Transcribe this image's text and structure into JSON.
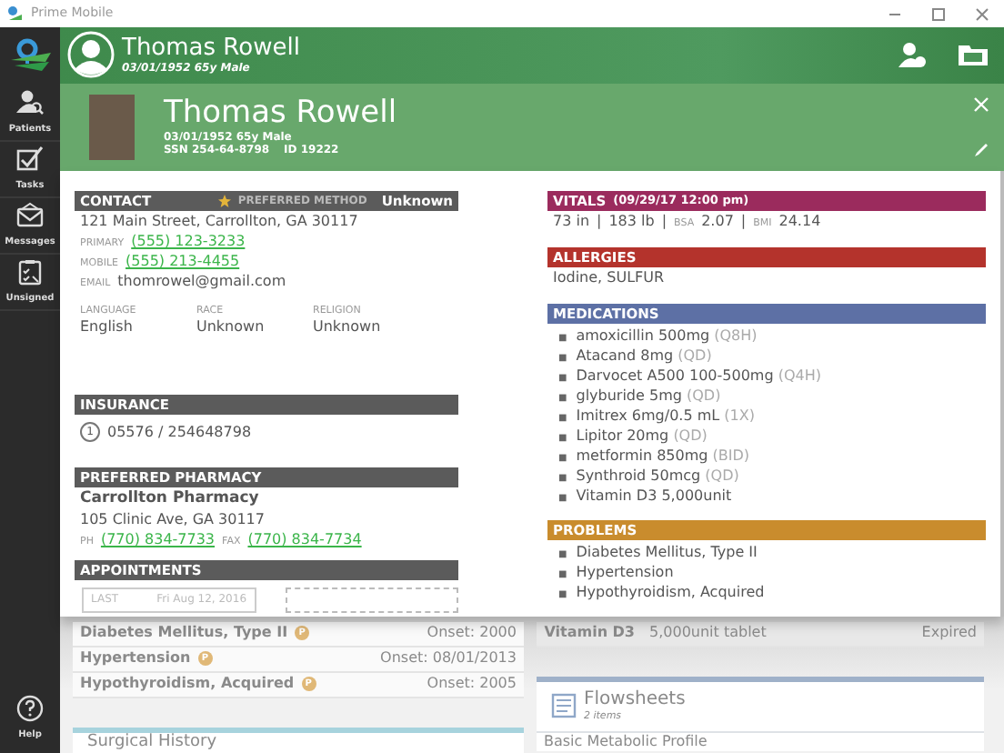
{
  "app": {
    "title": "Prime Mobile"
  },
  "sidebar": {
    "items": [
      {
        "kind": "patients",
        "label": "Patients"
      },
      {
        "kind": "tasks",
        "label": "Tasks"
      },
      {
        "kind": "messages",
        "label": "Messages"
      },
      {
        "kind": "unsigned",
        "label": "Unsigned"
      }
    ],
    "help": "Help"
  },
  "header": {
    "name": "Thomas Rowell",
    "info": "03/01/1952 65y Male"
  },
  "patient": {
    "name": "Thomas Rowell",
    "info": "03/01/1952 65y Male",
    "ssn": "SSN 254-64-8798",
    "id": "ID 19222"
  },
  "contact": {
    "title": "CONTACT",
    "preferred_label": "PREFERRED METHOD",
    "preferred_value": "Unknown",
    "address": "121 Main Street, Carrollton, GA 30117",
    "lines": [
      {
        "kind": "link",
        "label": "PRIMARY",
        "value": "(555) 123-3233"
      },
      {
        "kind": "link",
        "label": "MOBILE",
        "value": "(555) 213-4455"
      },
      {
        "kind": "text",
        "label": "EMAIL",
        "value": "thomrowel@gmail.com"
      }
    ],
    "demographics": [
      {
        "label": "LANGUAGE",
        "value": "English"
      },
      {
        "label": "RACE",
        "value": "Unknown"
      },
      {
        "label": "RELIGION",
        "value": "Unknown"
      }
    ]
  },
  "insurance": {
    "title": "INSURANCE",
    "entries": [
      {
        "number": "1",
        "value": "05576 / 254648798"
      }
    ]
  },
  "pharmacy": {
    "title": "PREFERRED PHARMACY",
    "name": "Carrollton Pharmacy",
    "address": "105 Clinic Ave, GA 30117",
    "phone_label": "PH",
    "phone": "(770) 834-7733",
    "fax_label": "FAX",
    "fax": "(770) 834-7734"
  },
  "appointments": {
    "title": "APPOINTMENTS",
    "last_label": "LAST",
    "last_date": "Fri Aug 12, 2016"
  },
  "vitals": {
    "title": "VITALS",
    "date": "(09/29/17 12:00 pm)",
    "separator": "|",
    "values": [
      {
        "value": "73 in"
      },
      {
        "value": "183 lb"
      },
      {
        "label": "BSA",
        "value": "2.07"
      },
      {
        "label": "BMI",
        "value": "24.14"
      }
    ]
  },
  "allergies": {
    "title": "ALLERGIES",
    "text": "Iodine, SULFUR"
  },
  "medications": {
    "title": "MEDICATIONS",
    "bullet": "■",
    "items": [
      {
        "name": "amoxicillin 500mg",
        "frequency": "(Q8H)"
      },
      {
        "name": "Atacand 8mg",
        "frequency": "(QD)"
      },
      {
        "name": "Darvocet A500 100-500mg",
        "frequency": "(Q4H)"
      },
      {
        "name": "glyburide 5mg",
        "frequency": "(QD)"
      },
      {
        "name": "Imitrex 6mg/0.5 mL",
        "frequency": "(1X)"
      },
      {
        "name": "Lipitor 20mg",
        "frequency": "(QD)"
      },
      {
        "name": "metformin 850mg",
        "frequency": "(BID)"
      },
      {
        "name": "Synthroid 50mcg",
        "frequency": "(QD)"
      },
      {
        "name": "Vitamin D3 5,000unit"
      }
    ]
  },
  "problems": {
    "title": "PROBLEMS",
    "bullet": "■",
    "items": [
      "Diabetes Mellitus, Type II",
      "Hypertension",
      "Hypothyroidism, Acquired"
    ]
  },
  "background": {
    "problems": [
      {
        "name": "Diabetes Mellitus, Type II",
        "badge": "P",
        "onset": "Onset: 2000"
      },
      {
        "name": "Hypertension",
        "badge": "P",
        "onset": "Onset: 08/01/2013"
      },
      {
        "name": "Hypothyroidism, Acquired",
        "badge": "P",
        "onset": "Onset: 2005"
      }
    ],
    "surgical_history": {
      "title": "Surgical History"
    },
    "medication_row": {
      "name": "Vitamin D3",
      "dose": "5,000unit tablet",
      "status": "Expired"
    },
    "flowsheets": {
      "title": "Flowsheets",
      "count": "2 items",
      "first_item": "Basic Metabolic Profile"
    }
  }
}
